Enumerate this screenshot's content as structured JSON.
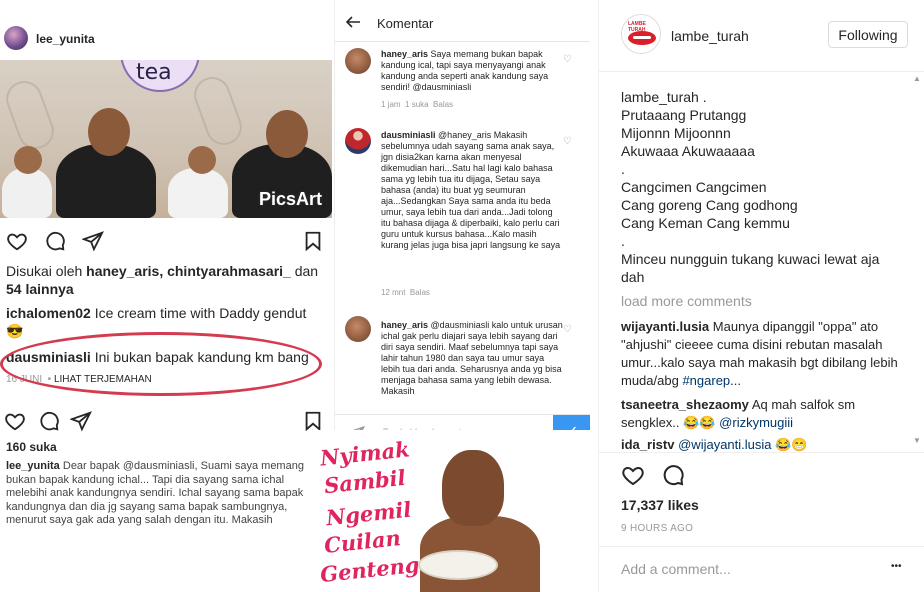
{
  "left": {
    "username": "lee_yunita",
    "photo_cup_text": "tea",
    "photo_watermark": "PicsArt",
    "liked_by_prefix": "Disukai oleh",
    "liked_by_users": "haney_aris, chintyarahmasari_",
    "liked_by_suffix": "dan",
    "liked_by_more": "54 lainnya",
    "caption_user": "ichalomen02",
    "caption_text": "Ice cream time with Daddy gendut",
    "caption_emoji": "😎",
    "comment_user": "dausminiasli",
    "comment_text": "Ini bukan bapak kandung km bang",
    "date": "16 JUNI",
    "translate_link": "LIHAT TERJEMAHAN",
    "likes2": "160 suka",
    "reply_user": "lee_yunita",
    "reply_mention": "@dausminiasli",
    "reply_text_a": "Dear bapak",
    "reply_text_b": ", Suami saya memang bukan bapak kandung ichal... Tapi dia sayang sama ichal melebihi anak kandungnya sendiri. Ichal sayang sama bapak kandungnya dan dia jg sayang sama bapak sambungnya, menurut saya gak ada yang salah dengan itu. Makasih"
  },
  "mid": {
    "title": "Komentar",
    "comments": [
      {
        "user": "haney_aris",
        "text": "Saya memang bukan bapak kandung ical, tapi saya menyayangi anak kandung anda seperti anak kandung saya sendiri!",
        "mention": "@dausminiasli",
        "meta_time": "1 jam",
        "meta_likes": "1 suka",
        "meta_reply": "Balas"
      },
      {
        "user": "dausminiasli",
        "mention": "@haney_aris",
        "text": "Makasih sebelumnya udah sayang sama anak saya, jgn disia2kan karna akan menyesal dikemudian hari...Satu hal lagi kalo bahasa sama yg lebih tua itu dijaga, Setau saya bahasa (anda) itu buat yg seumuran aja...Sedangkan Saya sama anda itu beda umur, saya lebih tua dari anda...Jadi tolong itu bahasa dijaga & diperbaiki, kalo perlu cari guru untuk kursus bahasa...Kalo masih kurang jelas juga bisa japri langsung ke saya",
        "meta_time": "12 mnt",
        "meta_reply": "Balas"
      },
      {
        "user": "haney_aris",
        "mention": "@dausminiasli",
        "text": "kalo untuk urusan ichal gak perlu diajari saya lebih sayang dari diri saya sendiri. Maaf sebelumnya tapi saya lahir tahun 1980 dan saya tau umur saya lebih tua dari anda. Seharusnya anda yg bisa menjaga bahasa sama yang lebih dewasa. Makasih"
      }
    ],
    "composer_placeholder": "Tambahkan komentar...",
    "send_check": "✓"
  },
  "meme": {
    "lines": [
      "Nyimak",
      "Sambil",
      "Ngemil",
      "Cuilan",
      "Genteng"
    ]
  },
  "right": {
    "username": "lambe_turah",
    "logo_text": "LAMBE TURAH",
    "follow_label": "Following",
    "caption_lines": [
      "lambe_turah .",
      "Prutaaang Prutangg",
      "Mijonnn Mijoonnn",
      "Akuwaaa Akuwaaaaa",
      ".",
      "Cangcimen Cangcimen",
      "Cang goreng Cang godhong",
      "Cang Keman Cang kemmu",
      ".",
      "Minceu nungguin tukang kuwaci lewat aja dah"
    ],
    "load_more": "load more comments",
    "comments": [
      {
        "user": "wijayanti.lusia",
        "text": "Maunya dipanggil \"oppa\" ato \"ahjushi\" cieeee cuma disini rebutan masalah umur...kalo saya mah makasih bgt dibilang lebih muda/abg",
        "tag": "#ngarep",
        "tail": "..."
      },
      {
        "user": "tsaneetra_shezaomy",
        "text": "Aq mah salfok sm sengklex..",
        "emoji": "😂😂",
        "mention": "@rizkymugiii"
      },
      {
        "user": "ida_ristv",
        "mention": "@wijayanti.lusia",
        "emoji": "😂😁"
      }
    ],
    "likes": "17,337 likes",
    "time": "9 HOURS AGO",
    "add_comment_placeholder": "Add a comment...",
    "more_dots": "•••"
  },
  "colors": {
    "ring": "#d43b4f",
    "meme_text": "#e0245e",
    "send": "#3897f0",
    "hashtag": "#003569"
  }
}
